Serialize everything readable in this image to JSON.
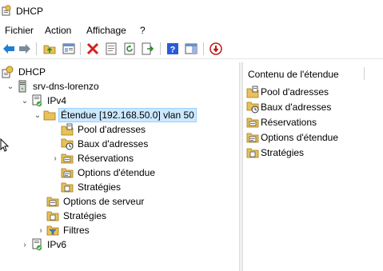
{
  "window": {
    "title": "DHCP"
  },
  "menu": [
    "Fichier",
    "Action",
    "Affichage",
    "?"
  ],
  "toolbar": {
    "icons": [
      "back-arrow-icon",
      "forward-arrow-icon",
      "up-folder-icon",
      "show-hide-tree-icon",
      "delete-icon",
      "properties-icon",
      "refresh-icon",
      "export-list-icon",
      "help-icon",
      "show-action-pane-icon",
      "stop-service-icon"
    ]
  },
  "tree": {
    "root": "DHCP",
    "server": "srv-dns-lorenzo",
    "ipv4": "IPv4",
    "scope": "Étendue [192.168.50.0] vlan 50",
    "pool": "Pool d'adresses",
    "leases": "Baux d'adresses",
    "reservations": "Réservations",
    "scope_options": "Options d'étendue",
    "scope_policies": "Stratégies",
    "server_options": "Options de serveur",
    "policies": "Stratégies",
    "filters": "Filtres",
    "ipv6": "IPv6"
  },
  "content": {
    "header": "Contenu de l'étendue",
    "items": [
      "Pool d'adresses",
      "Baux d'adresses",
      "Réservations",
      "Options d'étendue",
      "Stratégies"
    ]
  },
  "colors": {
    "selection_bg": "#cce8ff",
    "folder": "#e8c15a",
    "delete_red": "#d42020",
    "help_blue": "#2a5bd7",
    "arrow_blue": "#1f7fd6"
  }
}
